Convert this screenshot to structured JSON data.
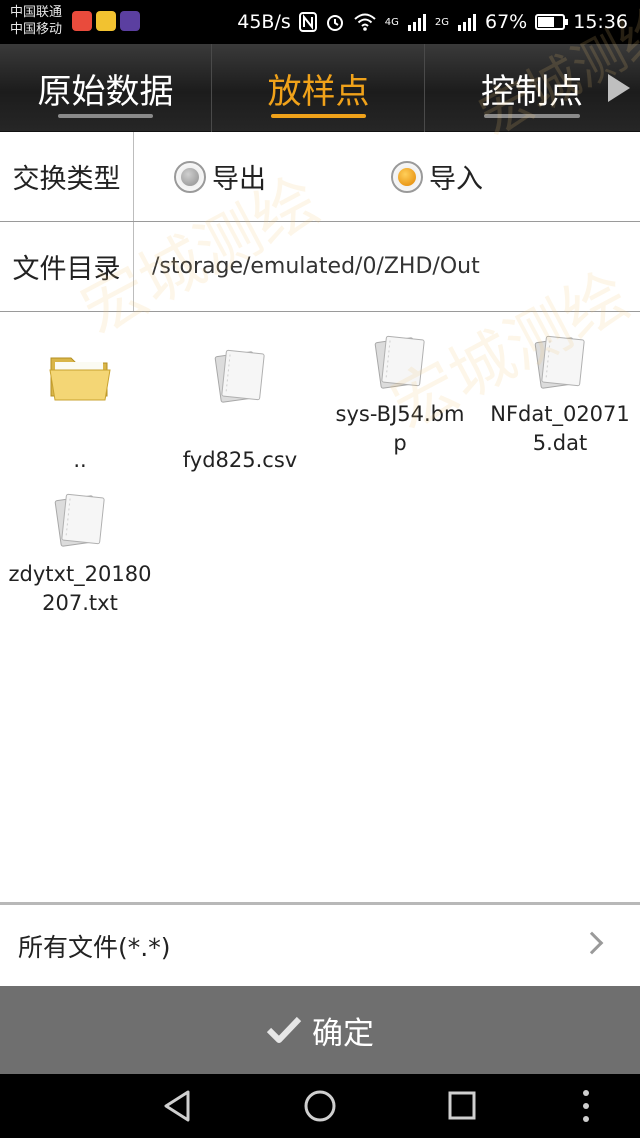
{
  "status_bar": {
    "carrier_1": "中国联通",
    "carrier_2": "中国移动",
    "net_speed": "45B/s",
    "battery": "67%",
    "battery_level": 0.67,
    "time": "15:36",
    "network_1": "4G",
    "network_2": "2G",
    "icons": [
      "weibo-app-icon",
      "sina-app-icon",
      "video-app-icon",
      "nfc-icon",
      "alarm-icon",
      "wifi-icon",
      "signal-icon",
      "battery-icon"
    ]
  },
  "tabs": [
    {
      "label": "原始数据",
      "active": false
    },
    {
      "label": "放样点",
      "active": true
    },
    {
      "label": "控制点",
      "active": false
    }
  ],
  "exchange_type": {
    "label": "交换类型",
    "options": [
      {
        "label": "导出",
        "selected": false
      },
      {
        "label": "导入",
        "selected": true
      }
    ]
  },
  "directory": {
    "label": "文件目录",
    "path": "/storage/emulated/0/ZHD/Out"
  },
  "files": [
    {
      "name": "..",
      "type": "folder"
    },
    {
      "name": "fyd825.csv",
      "type": "file"
    },
    {
      "name": "sys-BJ54.bmp",
      "type": "file"
    },
    {
      "name": "NFdat_020715.dat",
      "type": "file"
    },
    {
      "name": "zdytxt_20180207.txt",
      "type": "file"
    }
  ],
  "filter": {
    "label": "所有文件(*.*)"
  },
  "confirm": {
    "label": "确定"
  },
  "watermark": "宏城测绘",
  "colors": {
    "accent": "#f0a21a",
    "tabbar": "#262626",
    "confirm_bg": "#6f6f6f"
  }
}
